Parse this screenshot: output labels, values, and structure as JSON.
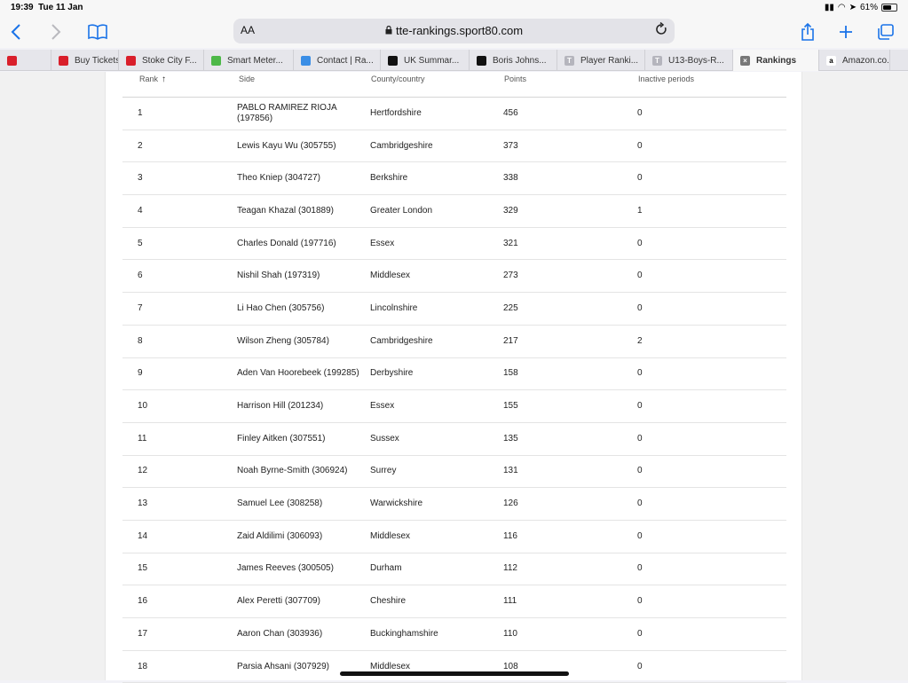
{
  "status": {
    "time": "19:39",
    "date": "Tue 11 Jan",
    "battery": "61%",
    "battery_level": 0.61
  },
  "browser": {
    "text_size_label": "AA",
    "url": "tte-rankings.sport80.com",
    "tabs": [
      {
        "label": "",
        "icon": "stoke-city-favicon",
        "color": "#d91f2b"
      },
      {
        "label": "Buy Tickets",
        "icon": "stoke-city-favicon",
        "color": "#d91f2b"
      },
      {
        "label": "Stoke City F...",
        "icon": "stoke-city-favicon",
        "color": "#d91f2b"
      },
      {
        "label": "Smart Meter...",
        "icon": "smart-meter-favicon",
        "color": "#4db848"
      },
      {
        "label": "Contact | Ra...",
        "icon": "contact-favicon",
        "color": "#3a8ee6"
      },
      {
        "label": "UK Summar...",
        "icon": "uk-summary-favicon",
        "color": "#111111"
      },
      {
        "label": "Boris Johns...",
        "icon": "bbc-favicon",
        "color": "#111111"
      },
      {
        "label": "Player Ranki...",
        "icon": "t-favicon",
        "color": "#b5b5bd",
        "glyph": "T"
      },
      {
        "label": "U13-Boys-R...",
        "icon": "t-favicon",
        "color": "#b5b5bd",
        "glyph": "T"
      },
      {
        "label": "Rankings",
        "icon": "close-tab-icon",
        "color": "#777777",
        "glyph": "×",
        "active": true
      },
      {
        "label": "Amazon.co....",
        "icon": "amazon-favicon",
        "color": "#ffffff",
        "glyph": "a"
      }
    ]
  },
  "table": {
    "headers": {
      "rank": "Rank",
      "side": "Side",
      "county": "County/country",
      "points": "Points",
      "inactive": "Inactive periods"
    },
    "rows": [
      {
        "rank": "1",
        "side": "PABLO RAMIREZ RIOJA (197856)",
        "county": "Hertfordshire",
        "points": "456",
        "inactive": "0"
      },
      {
        "rank": "2",
        "side": "Lewis Kayu Wu (305755)",
        "county": "Cambridgeshire",
        "points": "373",
        "inactive": "0"
      },
      {
        "rank": "3",
        "side": "Theo Kniep (304727)",
        "county": "Berkshire",
        "points": "338",
        "inactive": "0"
      },
      {
        "rank": "4",
        "side": "Teagan Khazal (301889)",
        "county": "Greater London",
        "points": "329",
        "inactive": "1"
      },
      {
        "rank": "5",
        "side": "Charles Donald (197716)",
        "county": "Essex",
        "points": "321",
        "inactive": "0"
      },
      {
        "rank": "6",
        "side": "Nishil Shah (197319)",
        "county": "Middlesex",
        "points": "273",
        "inactive": "0"
      },
      {
        "rank": "7",
        "side": "Li Hao Chen (305756)",
        "county": "Lincolnshire",
        "points": "225",
        "inactive": "0"
      },
      {
        "rank": "8",
        "side": "Wilson Zheng (305784)",
        "county": "Cambridgeshire",
        "points": "217",
        "inactive": "2"
      },
      {
        "rank": "9",
        "side": "Aden Van Hoorebeek (199285)",
        "county": "Derbyshire",
        "points": "158",
        "inactive": "0"
      },
      {
        "rank": "10",
        "side": "Harrison Hill (201234)",
        "county": "Essex",
        "points": "155",
        "inactive": "0"
      },
      {
        "rank": "11",
        "side": "Finley Aitken (307551)",
        "county": "Sussex",
        "points": "135",
        "inactive": "0"
      },
      {
        "rank": "12",
        "side": "Noah Byrne-Smith (306924)",
        "county": "Surrey",
        "points": "131",
        "inactive": "0"
      },
      {
        "rank": "13",
        "side": "Samuel Lee (308258)",
        "county": "Warwickshire",
        "points": "126",
        "inactive": "0"
      },
      {
        "rank": "14",
        "side": "Zaid Aldilimi (306093)",
        "county": "Middlesex",
        "points": "116",
        "inactive": "0"
      },
      {
        "rank": "15",
        "side": "James Reeves (300505)",
        "county": "Durham",
        "points": "112",
        "inactive": "0"
      },
      {
        "rank": "16",
        "side": "Alex Peretti (307709)",
        "county": "Cheshire",
        "points": "111",
        "inactive": "0"
      },
      {
        "rank": "17",
        "side": "Aaron Chan (303936)",
        "county": "Buckinghamshire",
        "points": "110",
        "inactive": "0"
      },
      {
        "rank": "18",
        "side": "Parsia Ahsani (307929)",
        "county": "Middlesex",
        "points": "108",
        "inactive": "0"
      }
    ]
  }
}
